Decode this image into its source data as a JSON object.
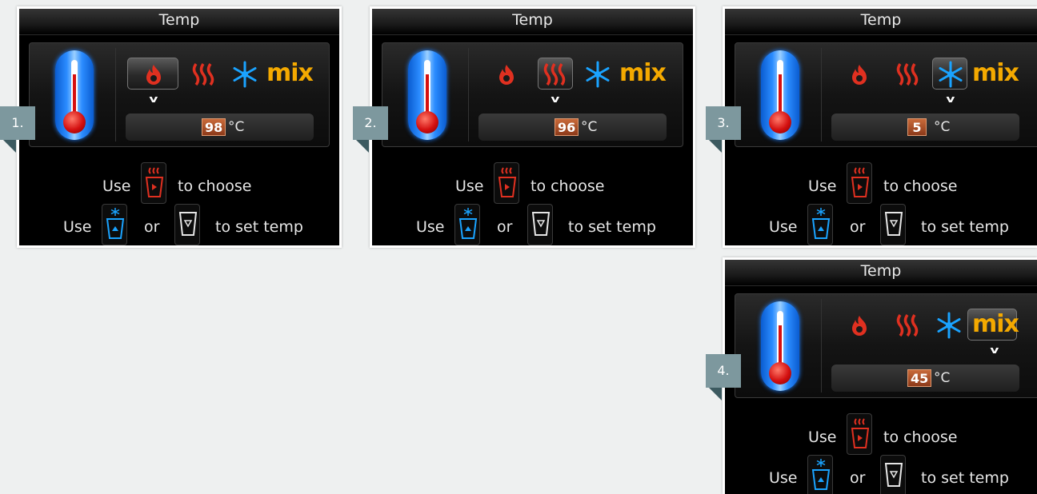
{
  "colors": {
    "accent_mix": "#f4a900",
    "heat_red": "#e03020",
    "cool_blue": "#1aa3ff",
    "badge": "#7d989e"
  },
  "icons": [
    "thermometer-icon",
    "flame-icon",
    "heat-waves-icon",
    "snowflake-icon",
    "select-button-icon",
    "up-button-icon",
    "down-button-icon"
  ],
  "screens": [
    {
      "step": "1.",
      "title": "Temp",
      "mode": "Flame",
      "temp": "98",
      "unit": "°C",
      "line1": {
        "use": "Use",
        "action": "to choose"
      },
      "line2": {
        "use": "Use",
        "or": "or",
        "action": "to set temp"
      },
      "mix_label": "mix"
    },
    {
      "step": "2.",
      "title": "Temp",
      "mode": "Heat",
      "temp": "96",
      "unit": "°C",
      "line1": {
        "use": "Use",
        "action": "to choose"
      },
      "line2": {
        "use": "Use",
        "or": "or",
        "action": "to set temp"
      },
      "mix_label": "mix"
    },
    {
      "step": "3.",
      "title": "Temp",
      "mode": "Cool",
      "temp": "5",
      "unit": "°C",
      "line1": {
        "use": "Use",
        "action": "to choose"
      },
      "line2": {
        "use": "Use",
        "or": "or",
        "action": "to set temp"
      },
      "mix_label": "mix"
    },
    {
      "step": "4.",
      "title": "Temp",
      "mode": "Mix",
      "temp": "45",
      "unit": "°C",
      "line1": {
        "use": "Use",
        "action": "to choose"
      },
      "line2": {
        "use": "Use",
        "or": "or",
        "action": "to set temp"
      },
      "mix_label": "mix"
    }
  ]
}
